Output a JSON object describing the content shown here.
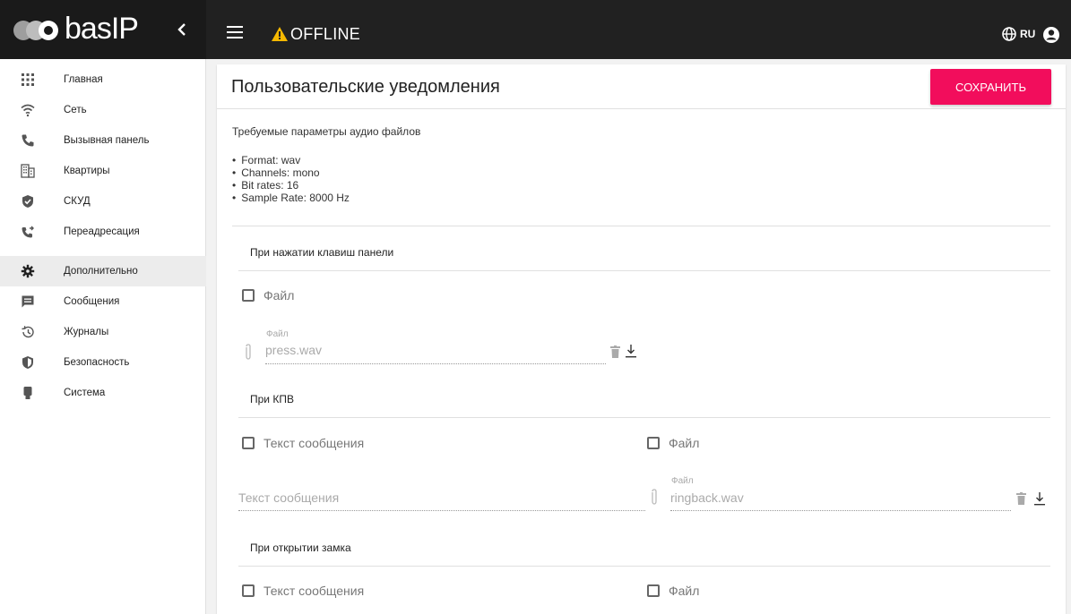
{
  "header": {
    "logo_text": "basIP",
    "status": "OFFLINE",
    "language": "RU"
  },
  "sidebar": {
    "items": [
      {
        "label": "Главная",
        "icon": "grid-icon"
      },
      {
        "label": "Сеть",
        "icon": "wifi-icon"
      },
      {
        "label": "Вызывная панель",
        "icon": "phone-icon"
      },
      {
        "label": "Квартиры",
        "icon": "building-icon"
      },
      {
        "label": "СКУД",
        "icon": "shield-check-icon"
      },
      {
        "label": "Переадресация",
        "icon": "phone-forward-icon"
      },
      {
        "label": "Дополнительно",
        "icon": "gear-icon"
      },
      {
        "label": "Сообщения",
        "icon": "message-icon"
      },
      {
        "label": "Журналы",
        "icon": "history-icon"
      },
      {
        "label": "Безопасность",
        "icon": "security-icon"
      },
      {
        "label": "Система",
        "icon": "device-icon"
      }
    ],
    "active_index": 6
  },
  "main": {
    "title": "Пользовательские уведомления",
    "save_label": "СОХРАНИТЬ",
    "requirements_title": "Требуемые параметры аудио файлов",
    "requirements": [
      "Format: wav",
      "Channels: mono",
      "Bit rates: 16",
      "Sample Rate: 8000 Hz"
    ],
    "sections": {
      "press": {
        "title": "При нажатии клавиш панели",
        "file_checkbox": "Файл",
        "file_label": "Файл",
        "file_value": "press.wav"
      },
      "kpv": {
        "title": "При КПВ",
        "text_checkbox": "Текст сообщения",
        "file_checkbox": "Файл",
        "text_placeholder": "Текст сообщения",
        "file_label": "Файл",
        "file_value": "ringback.wav"
      },
      "lock": {
        "title": "При открытии замка",
        "text_checkbox": "Текст сообщения",
        "file_checkbox": "Файл"
      }
    }
  },
  "colors": {
    "accent": "#f20d5c",
    "topbar": "#212121",
    "warning": "#f5b800"
  }
}
